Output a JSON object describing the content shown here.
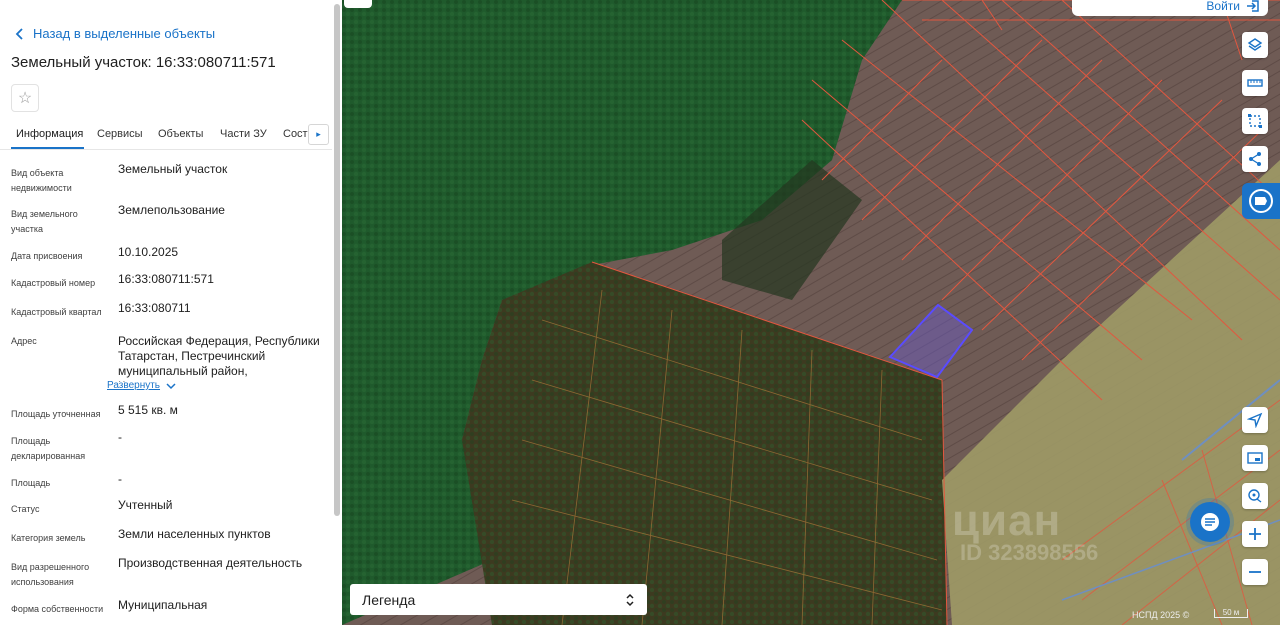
{
  "panel": {
    "back_label": "Назад в выделенные объекты",
    "title": "Земельный участок: 16:33:080711:571",
    "tabs": [
      "Информация",
      "Сервисы",
      "Объекты",
      "Части ЗУ",
      "Соста"
    ],
    "active_tab": "Информация",
    "expand_label": "Развернуть",
    "fields": [
      {
        "label": "Вид объекта недвижимости",
        "value": "Земельный участок"
      },
      {
        "label": "Вид земельного участка",
        "value": "Землепользование"
      },
      {
        "label": "Дата присвоения",
        "value": "10.10.2025"
      },
      {
        "label": "Кадастровый номер",
        "value": "16:33:080711:571"
      },
      {
        "label": "Кадастровый квартал",
        "value": "16:33:080711"
      },
      {
        "label": "Адрес",
        "value": "Российская Федерация, Республики Татарстан, Пестречинский муниципальный район, Кощаковское"
      },
      {
        "label": "Площадь уточненная",
        "value": "5 515 кв. м"
      },
      {
        "label": "Площадь декларированная",
        "value": "-"
      },
      {
        "label": "Площадь",
        "value": "-"
      },
      {
        "label": "Статус",
        "value": "Учтенный"
      },
      {
        "label": "Категория земель",
        "value": "Земли населенных пунктов"
      },
      {
        "label": "Вид разрешенного использования",
        "value": "Производственная деятельность"
      },
      {
        "label": "Форма собственности",
        "value": "Муниципальная"
      }
    ]
  },
  "map": {
    "login_label": "Войти",
    "legend_label": "Легенда",
    "attribution": "НСПД 2025 ©",
    "scale_label": "50 м",
    "watermark": "циан",
    "watermark_id": "ID 323898556",
    "tools": [
      "layers-icon",
      "ruler-icon",
      "select-area-icon",
      "share-icon",
      "locate-icon",
      "minimap-icon",
      "geo-search-icon",
      "zoom-in-icon",
      "zoom-out-icon"
    ],
    "colors": {
      "forest": "#1f5a2c",
      "field": "#6e5a52",
      "wood_lot": "#4a4a2a",
      "yellow_zone": "#a9a470",
      "parcel_line": "#e2573f",
      "selected_parcel": "#6a5acd",
      "accent": "#1a73c8"
    }
  }
}
